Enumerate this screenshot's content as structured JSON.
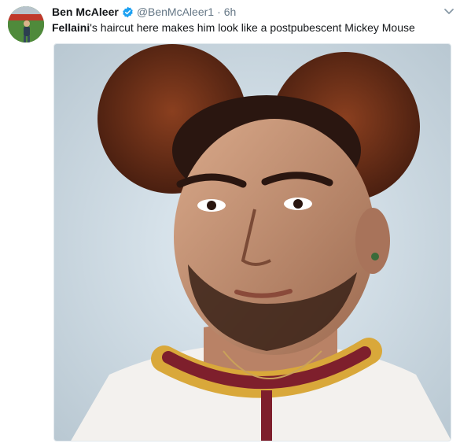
{
  "tweet": {
    "author_name": "Ben McAleer",
    "handle": "@BenMcAleer1",
    "separator": "·",
    "time": "6h",
    "text_bold": "Fellaini",
    "text_rest": "'s haircut here makes him look like a postpubescent Mickey Mouse"
  },
  "icons": {
    "verified": "verified-badge-icon",
    "caret": "chevron-down-icon"
  },
  "colors": {
    "verified_blue": "#1da1f2",
    "muted": "#657786",
    "text": "#14171a"
  }
}
